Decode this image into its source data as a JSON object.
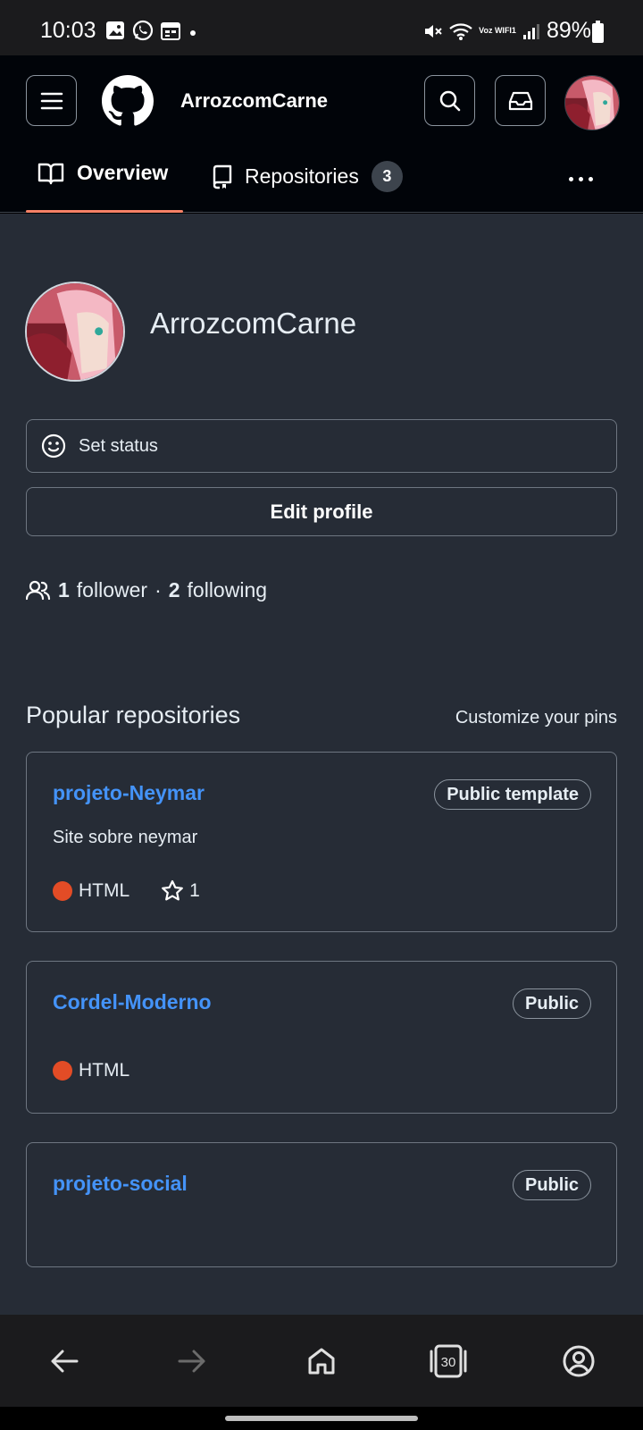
{
  "status_bar": {
    "time": "10:03",
    "network_label": "Voz WIFI1",
    "battery": "89%"
  },
  "header": {
    "title": "ArrozcomCarne",
    "icons": [
      "menu-icon",
      "github-logo",
      "search-icon",
      "inbox-icon",
      "avatar"
    ]
  },
  "tabs": [
    {
      "label": "Overview",
      "icon": "book-icon",
      "active": true
    },
    {
      "label": "Repositories",
      "icon": "repo-icon",
      "count": "3",
      "active": false
    }
  ],
  "profile": {
    "name": "ArrozcomCarne",
    "set_status_label": "Set status",
    "edit_profile_label": "Edit profile",
    "followers_count": "1",
    "followers_label": "follower",
    "separator": "·",
    "following_count": "2",
    "following_label": "following"
  },
  "popular": {
    "title": "Popular repositories",
    "customize_label": "Customize your pins",
    "repos": [
      {
        "name": "projeto-Neymar",
        "visibility": "Public template",
        "description": "Site sobre neymar",
        "language": "HTML",
        "stars": "1"
      },
      {
        "name": "Cordel-Moderno",
        "visibility": "Public",
        "language": "HTML"
      },
      {
        "name": "projeto-social",
        "visibility": "Public"
      }
    ]
  },
  "bottom_nav": {
    "tab_count": "30",
    "icons": [
      "back-arrow-icon",
      "forward-arrow-icon",
      "home-icon",
      "tabs-icon",
      "account-icon"
    ]
  },
  "colors": {
    "accent_link": "#4493f8",
    "tab_underline": "#f78166",
    "html_lang": "#e34c26",
    "background": "#262c36",
    "header_bg": "#010409"
  }
}
